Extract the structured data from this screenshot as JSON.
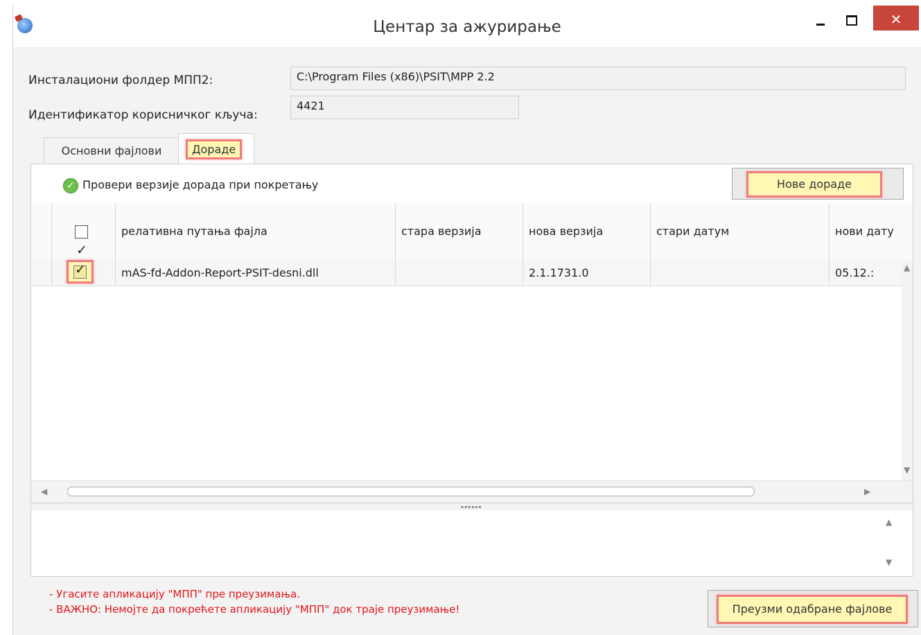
{
  "window": {
    "title": "Центар за ажурирање",
    "close_glyph": "✕",
    "icon": "app-globe-icon"
  },
  "form": {
    "install_folder_label": "Инсталациони фолдер МПП2:",
    "install_folder_value": "C:\\Program Files (x86)\\PSIT\\MPP 2.2",
    "user_key_label": "Идентификатор корисничког кључа:",
    "user_key_value": "4421"
  },
  "tabs": [
    {
      "label": "Основни фајлови",
      "active": false
    },
    {
      "label": "Дораде",
      "active": true
    }
  ],
  "addons": {
    "check_on_start_label": "Провери верзије дорада при покретању",
    "new_addons_button": "Нове дораде",
    "columns": [
      "релативна путања фајла",
      "стара верзија",
      "нова верзија",
      "стари датум",
      "нови дату"
    ],
    "rows": [
      {
        "checked": true,
        "path": "mAS-fd-Addon-Report-PSIT-desni.dll",
        "old_version": "",
        "new_version": "2.1.1731.0",
        "old_date": "",
        "new_date": "05.12.:"
      }
    ]
  },
  "notes": [
    "- Угасите апликацију \"МПП\" пре преузимања.",
    "- ВАЖНО: Немојте да покрећете апликацију \"МПП\" док траје преузимање!"
  ],
  "download_button": "Преузми одабране фајлове",
  "colors": {
    "highlight_fill": "#fff7b3",
    "highlight_border": "#f07b7b",
    "warning_text": "#e4141a",
    "close_button": "#c7453b"
  }
}
